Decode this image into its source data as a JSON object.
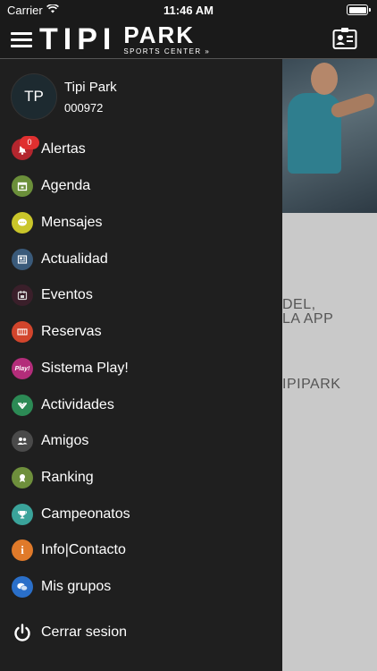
{
  "status_bar": {
    "carrier": "Carrier",
    "time": "11:46 AM"
  },
  "header": {
    "logo_left": "TIPI",
    "logo_right": "PARK",
    "logo_sub": "SPORTS CENTER »"
  },
  "background": {
    "line1": "DEL,",
    "line2": "LA APP",
    "line3": "IPIPARK"
  },
  "profile": {
    "initials": "TP",
    "name": "Tipi Park",
    "id": "000972"
  },
  "menu": [
    {
      "label": "Alertas",
      "icon": "bell-icon",
      "color": "#b3262e",
      "badge": "0"
    },
    {
      "label": "Agenda",
      "icon": "calendar-icon",
      "color": "#6b8f3a"
    },
    {
      "label": "Mensajes",
      "icon": "chat-icon",
      "color": "#c9c52a"
    },
    {
      "label": "Actualidad",
      "icon": "news-icon",
      "color": "#3a5a7a"
    },
    {
      "label": "Eventos",
      "icon": "event-icon",
      "color": "#3a1f2a"
    },
    {
      "label": "Reservas",
      "icon": "court-icon",
      "color": "#d2452c"
    },
    {
      "label": "Sistema Play!",
      "icon": "play-icon",
      "color": "#b32d7a",
      "icon_text": "Play!"
    },
    {
      "label": "Actividades",
      "icon": "activity-icon",
      "color": "#2c8a55"
    },
    {
      "label": "Amigos",
      "icon": "friends-icon",
      "color": "#4a4a4a"
    },
    {
      "label": "Ranking",
      "icon": "medal-icon",
      "color": "#6e8f3c"
    },
    {
      "label": "Campeonatos",
      "icon": "trophy-icon",
      "color": "#3aa39a"
    },
    {
      "label": "Info|Contacto",
      "icon": "info-icon",
      "color": "#e07a2a",
      "icon_text": "i"
    },
    {
      "label": "Mis grupos",
      "icon": "groups-icon",
      "color": "#2a6fc9"
    },
    {
      "label": "Cerrar sesion",
      "icon": "power-icon",
      "color": "#ffffff"
    }
  ]
}
